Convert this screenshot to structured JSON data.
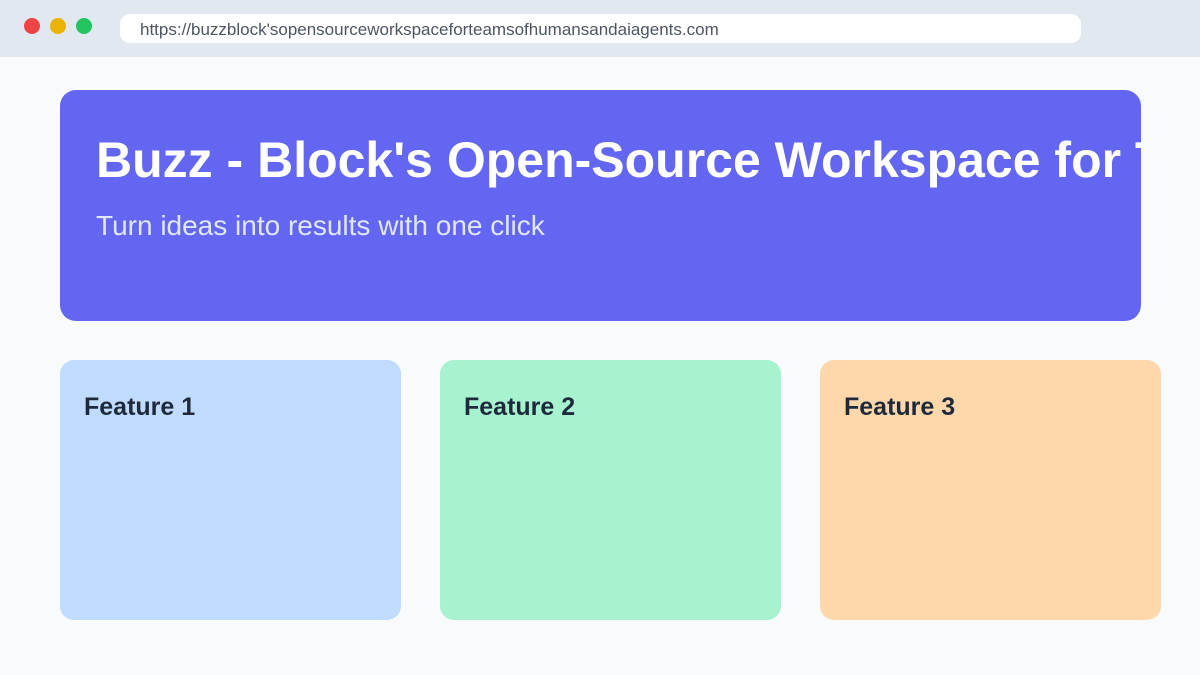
{
  "browser": {
    "url": "https://buzzblock'sopensourceworkspaceforteamsofhumansandaiagents.com",
    "controls": {
      "close_color": "#ef4444",
      "minimize_color": "#eab308",
      "maximize_color": "#22c55e"
    }
  },
  "hero": {
    "title": "Buzz - Block's Open-Source Workspace for Tea",
    "overflow_text": "Tea",
    "subtitle": "Turn ideas into results with one click",
    "background_color": "#6366f1",
    "subtitle_color": "#e0e7ff"
  },
  "features": [
    {
      "title": "Feature 1",
      "color": "#bfdbfe"
    },
    {
      "title": "Feature 2",
      "color": "#a7f3d0"
    },
    {
      "title": "Feature 3",
      "color": "#fed7aa"
    }
  ]
}
